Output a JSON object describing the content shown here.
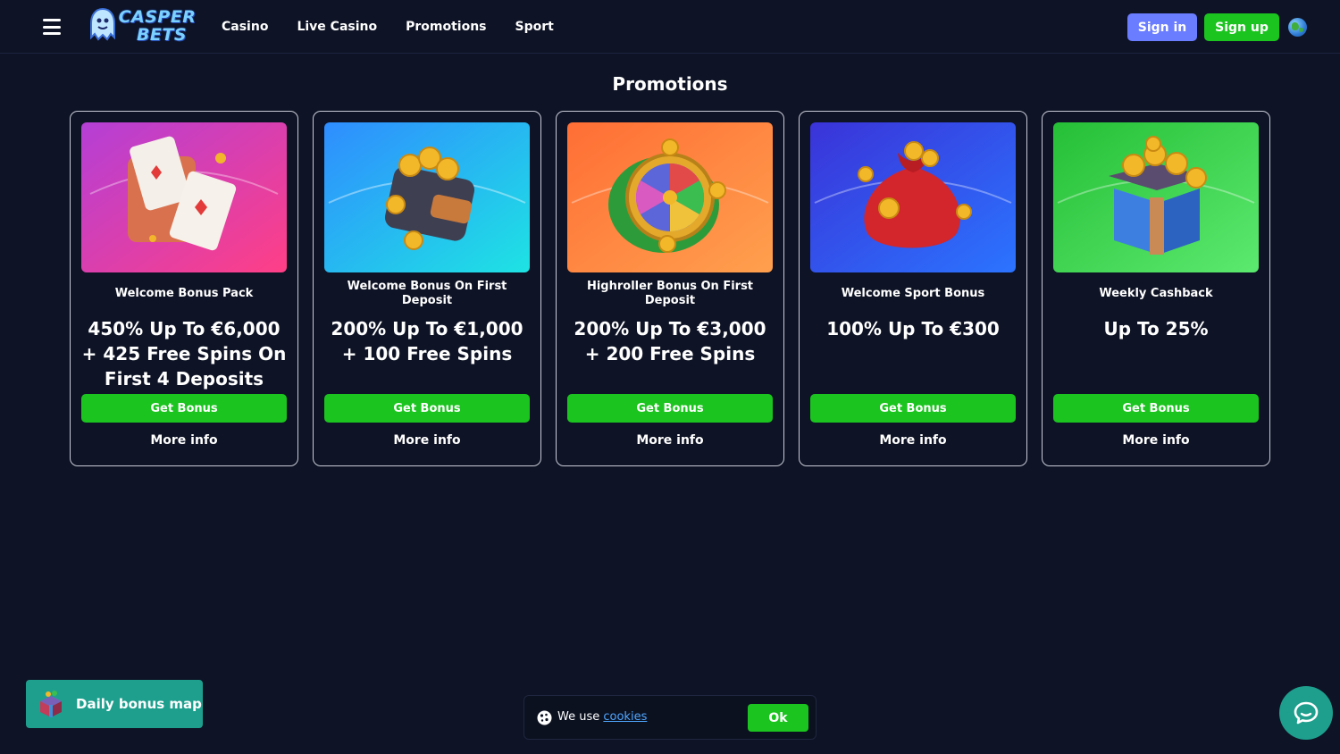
{
  "header": {
    "logo_text_line1": "CASPER",
    "logo_text_line2": "BETS",
    "nav": [
      "Casino",
      "Live Casino",
      "Promotions",
      "Sport"
    ],
    "sign_in": "Sign in",
    "sign_up": "Sign up",
    "menu_icon": "hamburger-icon",
    "language_icon": "globe-icon"
  },
  "page_title": "Promotions",
  "promotions": [
    {
      "subtitle": "Welcome Bonus Pack",
      "headline": "450% Up To €6,000 + 425 Free Spins On First 4 Deposits",
      "button": "Get Bonus",
      "more": "More info",
      "image": "playing-cards-illustration",
      "bg_from": "#c24bd6",
      "bg_to": "#ff3f7f"
    },
    {
      "subtitle": "Welcome Bonus On First Deposit",
      "headline": "200% Up To €1,000 + 100 Free Spins",
      "button": "Get Bonus",
      "more": "More info",
      "image": "wallet-coins-illustration",
      "bg_from": "#2fa8ff",
      "bg_to": "#1ee0e0"
    },
    {
      "subtitle": "Highroller Bonus On First Deposit",
      "headline": "200% Up To €3,000 + 200 Free Spins",
      "button": "Get Bonus",
      "more": "More info",
      "image": "fortune-wheel-illustration",
      "bg_from": "#ff7a3a",
      "bg_to": "#ff9c4a"
    },
    {
      "subtitle": "Welcome Sport Bonus",
      "headline": "100% Up To €300",
      "button": "Get Bonus",
      "more": "More info",
      "image": "money-bag-illustration",
      "bg_from": "#3c3fe0",
      "bg_to": "#2a6cff"
    },
    {
      "subtitle": "Weekly Cashback",
      "headline": "Up To 25%",
      "button": "Get Bonus",
      "more": "More info",
      "image": "gift-box-coins-illustration",
      "bg_from": "#2ac43a",
      "bg_to": "#55e86a"
    }
  ],
  "daily_bonus": {
    "label": "Daily bonus map",
    "icon": "treasure-chest-icon"
  },
  "cookie": {
    "text": "We use",
    "link": "cookies",
    "ok": "Ok",
    "icon": "cookie-icon"
  },
  "chat": {
    "icon": "chat-bubble-icon"
  },
  "colors": {
    "background": "#0e1325",
    "accent_green": "#1bc41f",
    "accent_blue": "#6a7cff",
    "teal": "#1e9f8e"
  }
}
